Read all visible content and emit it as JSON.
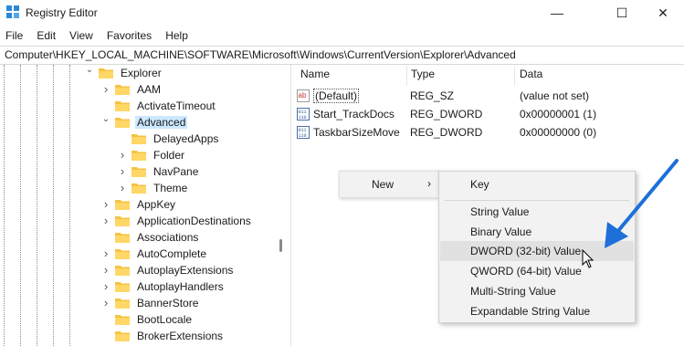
{
  "window": {
    "title": "Registry Editor",
    "minimize_glyph": "—",
    "maximize_glyph": "☐",
    "close_glyph": "✕"
  },
  "menu": [
    "File",
    "Edit",
    "View",
    "Favorites",
    "Help"
  ],
  "address": "Computer\\HKEY_LOCAL_MACHINE\\SOFTWARE\\Microsoft\\Windows\\CurrentVersion\\Explorer\\Advanced",
  "tree": {
    "items": [
      {
        "label": "Explorer",
        "expander": "expanded"
      },
      {
        "label": "AAM",
        "expander": "collapsed"
      },
      {
        "label": "ActivateTimeout",
        "expander": "none"
      },
      {
        "label": "Advanced",
        "expander": "expanded",
        "selected": true
      },
      {
        "label": "DelayedApps",
        "expander": "none"
      },
      {
        "label": "Folder",
        "expander": "collapsed"
      },
      {
        "label": "NavPane",
        "expander": "collapsed"
      },
      {
        "label": "Theme",
        "expander": "collapsed"
      },
      {
        "label": "AppKey",
        "expander": "collapsed"
      },
      {
        "label": "ApplicationDestinations",
        "expander": "collapsed"
      },
      {
        "label": "Associations",
        "expander": "none"
      },
      {
        "label": "AutoComplete",
        "expander": "collapsed"
      },
      {
        "label": "AutoplayExtensions",
        "expander": "collapsed"
      },
      {
        "label": "AutoplayHandlers",
        "expander": "collapsed"
      },
      {
        "label": "BannerStore",
        "expander": "collapsed"
      },
      {
        "label": "BootLocale",
        "expander": "none"
      },
      {
        "label": "BrokerExtensions",
        "expander": "none"
      }
    ]
  },
  "list": {
    "columns": {
      "name": "Name",
      "type": "Type",
      "data": "Data"
    },
    "rows": [
      {
        "name": "(Default)",
        "type": "REG_SZ",
        "data": "(value not set)",
        "icon": "string-value-icon"
      },
      {
        "name": "Start_TrackDocs",
        "type": "REG_DWORD",
        "data": "0x00000001 (1)",
        "icon": "binary-value-icon"
      },
      {
        "name": "TaskbarSizeMove",
        "type": "REG_DWORD",
        "data": "0x00000000 (0)",
        "icon": "binary-value-icon"
      }
    ]
  },
  "context_menu": {
    "label": "New",
    "arrow": "›",
    "submenu": [
      "Key",
      "String Value",
      "Binary Value",
      "DWORD (32-bit) Value",
      "QWORD (64-bit) Value",
      "Multi-String Value",
      "Expandable String Value"
    ],
    "highlighted": "DWORD (32-bit) Value"
  },
  "colors": {
    "accent": "#1e6fd9",
    "selection": "#cce8ff",
    "folder": "#f5c342"
  }
}
